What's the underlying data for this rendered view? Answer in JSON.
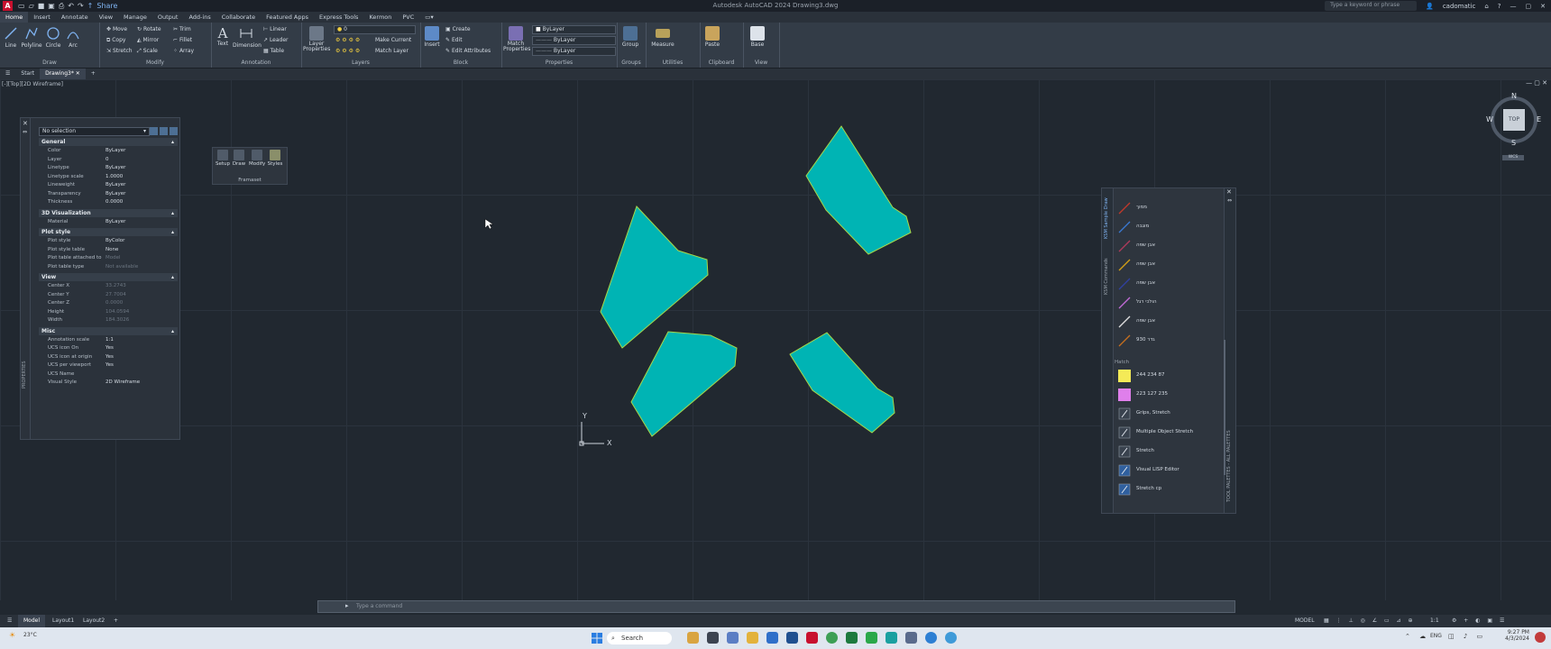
{
  "title_bar": {
    "app_title": "Autodesk AutoCAD 2024  Drawing3.dwg",
    "share_label": "Share",
    "search_placeholder": "Type a keyword or phrase",
    "user": "cadomatic"
  },
  "ribbon_tabs": [
    "Home",
    "Insert",
    "Annotate",
    "View",
    "Manage",
    "Output",
    "Add-ins",
    "Collaborate",
    "Featured Apps",
    "Express Tools",
    "Kermon",
    "PVC"
  ],
  "ribbon": {
    "draw": {
      "label": "Draw",
      "tools": [
        "Line",
        "Polyline",
        "Circle",
        "Arc"
      ]
    },
    "modify": {
      "label": "Modify",
      "tools": [
        "Move",
        "Rotate",
        "Trim",
        "Copy",
        "Mirror",
        "Fillet",
        "Stretch",
        "Scale",
        "Array"
      ]
    },
    "annotation": {
      "label": "Annotation",
      "tools": [
        "Text",
        "Dimension",
        "Linear",
        "Leader",
        "Table"
      ]
    },
    "layers": {
      "label": "Layers",
      "tools": [
        "Layer Properties",
        "Make Current",
        "Match Layer"
      ],
      "current_layer": "0"
    },
    "block": {
      "label": "Block",
      "tools": [
        "Insert",
        "Create",
        "Edit",
        "Edit Attributes"
      ]
    },
    "properties": {
      "label": "Properties",
      "tools": [
        "Match Properties"
      ],
      "color": "ByLayer",
      "linetype": "ByLayer",
      "lineweight": "ByLayer"
    },
    "groups": {
      "label": "Groups",
      "tools": [
        "Group"
      ]
    },
    "utilities": {
      "label": "Utilities",
      "tools": [
        "Measure"
      ]
    },
    "clipboard": {
      "label": "Clipboard",
      "tools": [
        "Paste"
      ]
    },
    "view": {
      "label": "View",
      "tools": [
        "Base"
      ]
    }
  },
  "file_tabs": [
    "Start",
    "Drawing3*"
  ],
  "viewport_label": "[-][Top][2D Wireframe]",
  "properties_palette": {
    "selection": "No selection",
    "vertical_title": "PROPERTIES",
    "categories": [
      {
        "name": "General",
        "rows": [
          {
            "k": "Color",
            "v": "ByLayer"
          },
          {
            "k": "Layer",
            "v": "0"
          },
          {
            "k": "Linetype",
            "v": "ByLayer"
          },
          {
            "k": "Linetype scale",
            "v": "1.0000"
          },
          {
            "k": "Lineweight",
            "v": "ByLayer"
          },
          {
            "k": "Transparency",
            "v": "ByLayer"
          },
          {
            "k": "Thickness",
            "v": "0.0000"
          }
        ]
      },
      {
        "name": "3D Visualization",
        "rows": [
          {
            "k": "Material",
            "v": "ByLayer"
          }
        ]
      },
      {
        "name": "Plot style",
        "rows": [
          {
            "k": "Plot style",
            "v": "ByColor"
          },
          {
            "k": "Plot style table",
            "v": "None"
          },
          {
            "k": "Plot table attached to",
            "v": "Model"
          },
          {
            "k": "Plot table type",
            "v": "Not available"
          }
        ]
      },
      {
        "name": "View",
        "rows": [
          {
            "k": "Center X",
            "v": "33.2743"
          },
          {
            "k": "Center Y",
            "v": "27.7004"
          },
          {
            "k": "Center Z",
            "v": "0.0000"
          },
          {
            "k": "Height",
            "v": "104.0594"
          },
          {
            "k": "Width",
            "v": "184.3026"
          }
        ]
      },
      {
        "name": "Misc",
        "rows": [
          {
            "k": "Annotation scale",
            "v": "1:1"
          },
          {
            "k": "UCS icon On",
            "v": "Yes"
          },
          {
            "k": "UCS icon at origin",
            "v": "Yes"
          },
          {
            "k": "UCS per viewport",
            "v": "Yes"
          },
          {
            "k": "UCS Name",
            "v": ""
          },
          {
            "k": "Visual Style",
            "v": "2D Wireframe"
          }
        ]
      }
    ]
  },
  "framaset_toolbar": {
    "tools": [
      "Setup",
      "Draw",
      "Modify",
      "Styles"
    ],
    "label": "Framaset"
  },
  "viewcube": {
    "n": "N",
    "s": "S",
    "e": "E",
    "w": "W",
    "face": "TOP",
    "wcs": "WCS"
  },
  "ucs": {
    "x": "X",
    "y": "Y"
  },
  "tool_palette": {
    "title": "TOOL PALETTES - ALL PALETTES",
    "side_tabs": [
      "KSM Sample Draw",
      "KSM Commands"
    ],
    "lines": [
      {
        "label": "ממוך",
        "color": "#c0392b"
      },
      {
        "label": "מוגבה",
        "color": "#3a7bd5"
      },
      {
        "label": "אבן שפה",
        "color": "#b03a5b"
      },
      {
        "label": "אבן שפה",
        "color": "#d4a017"
      },
      {
        "label": "אבן שפה",
        "color": "#3040a0"
      },
      {
        "label": "הולכי רגל",
        "color": "#c36bd8"
      },
      {
        "label": "אבן שפה",
        "color": "#e0e0e0"
      },
      {
        "label": "גדר 930",
        "color": "#c8701e"
      }
    ],
    "hatch_section": "Hatch",
    "hatches": [
      {
        "label": "244 234 87",
        "color": "#f4ea57"
      },
      {
        "label": "223 127 235",
        "color": "#df7feb"
      }
    ],
    "commands": [
      "Grips, Stretch",
      "Multiple Object Stretch",
      "Stretch",
      "Visual LISP Editor",
      "Stretch cp"
    ]
  },
  "command_line": {
    "placeholder": "Type a command"
  },
  "layout_tabs": [
    "Model",
    "Layout1",
    "Layout2"
  ],
  "status_bar": {
    "space": "MODEL",
    "scale": "1:1"
  },
  "taskbar": {
    "weather_temp": "23°C",
    "search": "Search",
    "language": "ENG",
    "time": "9:27 PM",
    "date": "4/3/2024"
  },
  "colors": {
    "shape_fill": "#00b4b4",
    "shape_edge": "#a8d84a",
    "canvas": "#212830"
  }
}
